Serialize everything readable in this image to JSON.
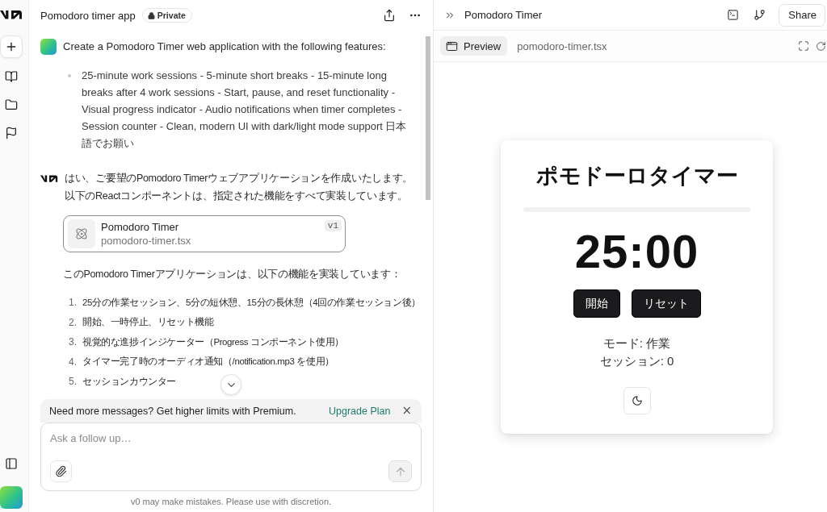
{
  "chat_header": {
    "title": "Pomodoro timer app",
    "visibility": "Private"
  },
  "messages": [
    {
      "kind": "user",
      "text": "Create a Pomodoro Timer web application with the following features:",
      "bullets": [
        "25-minute work sessions - 5-minute short breaks - 15-minute long breaks after 4 work sessions - Start, pause, and reset functionality - Visual progress indicator - Audio notifications when timer completes - Session counter - Clean, modern UI with dark/light mode support 日本語でお願い"
      ]
    },
    {
      "kind": "assistant",
      "text": "はい、ご要望のPomodoro Timerウェブアプリケーションを作成いたします。以下のReactコンポーネントは、指定された機能をすべて実装しています。",
      "artifact": {
        "title": "Pomodoro Timer",
        "file": "pomodoro-timer.tsx",
        "version": "v1"
      },
      "summary": "このPomodoro Timerアプリケーションは、以下の機能を実装しています：",
      "list": [
        {
          "number": "1.",
          "text": "25分の作業セッション、5分の短休憩、15分の長休憩（4回の作業セッション後）"
        },
        {
          "number": "2.",
          "text": "開始、一時停止、リセット機能"
        },
        {
          "number": "3.",
          "text": "視覚的な進捗インジケーター（Progress コンポーネント使用）"
        },
        {
          "number": "4.",
          "text": "タイマー完了時のオーディオ通知（/notification.mp3 を使用）"
        },
        {
          "number": "5.",
          "text": "セッションカウンター"
        }
      ]
    }
  ],
  "banner": {
    "text": "Need more messages? Get higher limits with Premium.",
    "link": "Upgrade Plan",
    "close": "×"
  },
  "composer": {
    "placeholder": "Ask a follow up…"
  },
  "footer_note": "v0 may make mistakes. Please use with discretion.",
  "preview_header": {
    "title": "Pomodoro Timer",
    "share": "Share"
  },
  "tabs": [
    {
      "label": "Preview",
      "selected": true
    },
    {
      "label": "pomodoro-timer.tsx",
      "selected": false
    }
  ],
  "timer_app": {
    "title": "ポモドーロタイマー",
    "progress": {
      "level": 0
    },
    "time": "25:00",
    "buttons": [
      {
        "label": "開始"
      },
      {
        "label": "リセット"
      }
    ],
    "mode": "モード: 作業",
    "session": "セッション: 0"
  }
}
